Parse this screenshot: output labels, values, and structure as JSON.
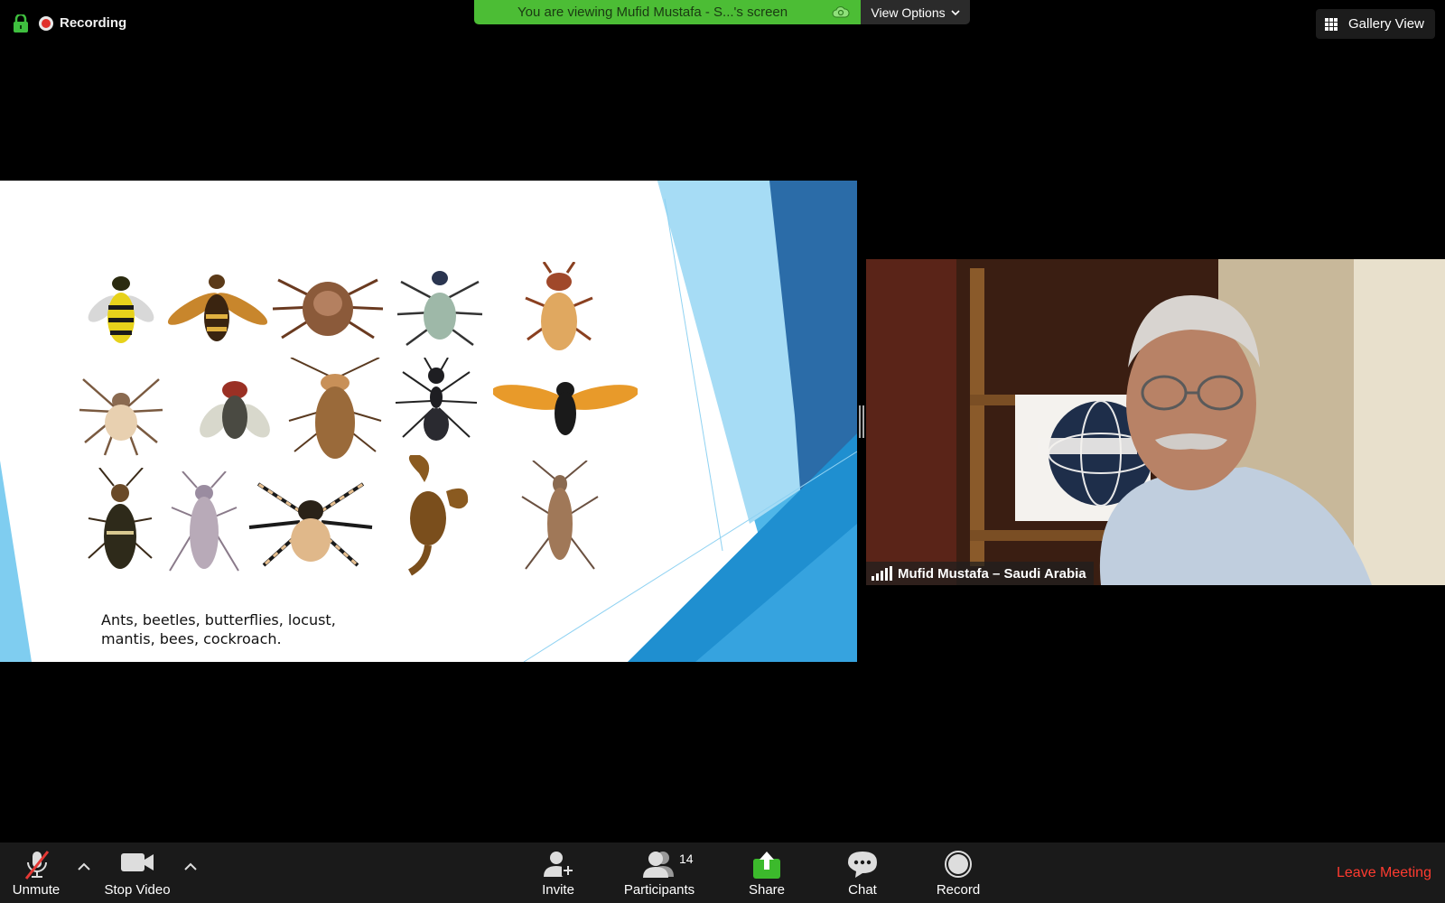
{
  "top_bar": {
    "recording_label": "Recording",
    "viewing_banner": "You are viewing Mufid Mustafa - S...'s screen",
    "view_options_label": "View Options",
    "gallery_view_label": "Gallery View"
  },
  "slide": {
    "caption": "Ants, beetles, butterflies, locust,\nmantis, bees, cockroach.",
    "accent_colors": [
      "#4fb6e8",
      "#1f8fd0",
      "#2b6ca8",
      "#a6dcf5"
    ]
  },
  "participant": {
    "name": "Mufid Mustafa – Saudi Arabia"
  },
  "toolbar": {
    "unmute": "Unmute",
    "stop_video": "Stop Video",
    "invite": "Invite",
    "participants": "Participants",
    "participants_count": "14",
    "share": "Share",
    "chat": "Chat",
    "record": "Record",
    "leave": "Leave Meeting"
  },
  "colors": {
    "banner_green": "#4cbd35",
    "leave_red": "#ff3b30",
    "toolbar_bg": "#1a1a1a"
  }
}
